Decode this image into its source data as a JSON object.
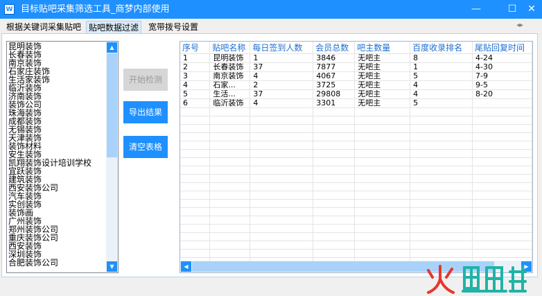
{
  "window": {
    "title": "目标贴吧采集筛选工具_商梦内部使用",
    "app_icon": "W",
    "controls": {
      "minimize": "—",
      "maximize": "☐",
      "close": "✕"
    }
  },
  "tabs": [
    {
      "label": "根据关键词采集贴吧",
      "active": false
    },
    {
      "label": "贴吧数据过滤",
      "active": true
    },
    {
      "label": "宽带拨号设置",
      "active": false
    }
  ],
  "list": {
    "items": [
      "昆明装饰",
      "长春装饰",
      "南京装饰",
      "石家庄装饰",
      "生活家装饰",
      "临沂装饰",
      "济南装饰",
      "装饰公司",
      "珠海装饰",
      "成都装饰",
      "无锡装饰",
      "天津装饰",
      "装饰材料",
      "安生装饰",
      "凯翔装饰设计培训学校",
      "宜跃装饰",
      "建筑装饰",
      "西安装饰公司",
      "汽车装饰",
      "实创装饰",
      "装饰画",
      "广州装饰",
      "郑州装饰公司",
      "重庆装饰公司",
      "西安装饰",
      "深圳装饰",
      "合肥装饰公司"
    ]
  },
  "buttons": {
    "start": "开始检测",
    "export": "导出结果",
    "clear": "清空表格"
  },
  "table": {
    "columns": [
      "序号",
      "贴吧名称",
      "每日签到人数",
      "会员总数",
      "吧主数量",
      "百度收录排名",
      "尾贴回复时间"
    ],
    "rows": [
      [
        "1",
        "昆明装饰",
        "1",
        "3846",
        "无吧主",
        "8",
        "4-24"
      ],
      [
        "2",
        "长春装饰",
        "37",
        "7877",
        "无吧主",
        "1",
        "4-30"
      ],
      [
        "3",
        "南京装饰",
        "4",
        "4067",
        "无吧主",
        "5",
        "7-9"
      ],
      [
        "4",
        "石家...",
        "2",
        "3725",
        "无吧主",
        "4",
        "9-5"
      ],
      [
        "5",
        "生活...",
        "37",
        "29808",
        "无吧主",
        "4",
        "8-20"
      ],
      [
        "6",
        "临沂装饰",
        "4",
        "3301",
        "无吧主",
        "5",
        ""
      ]
    ]
  },
  "scroll_arrows": {
    "up": "▲",
    "down": "▼",
    "left": "◀",
    "right": "▶",
    "tabs": "◂▸"
  },
  "colors": {
    "accent": "#1e90ff",
    "header_text": "#1e6fd0",
    "disabled_bg": "#d6d6d6",
    "watermark_red": "#e8362c",
    "watermark_teal": "#20b3a6"
  }
}
